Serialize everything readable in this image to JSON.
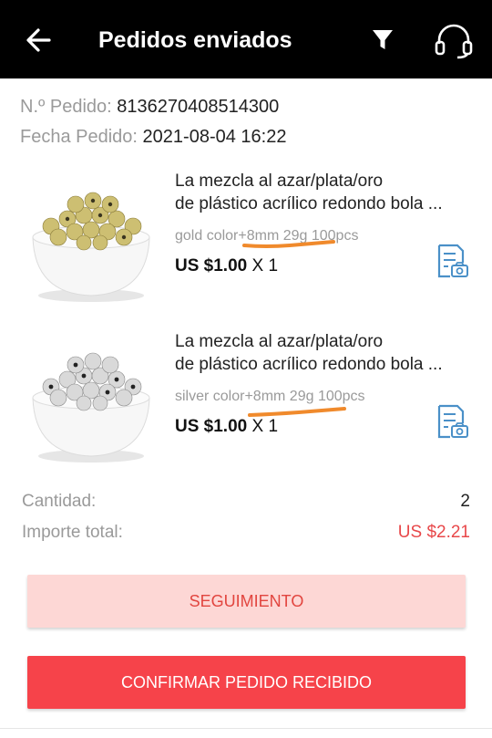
{
  "header": {
    "title": "Pedidos enviados",
    "back_icon": "arrow-left-icon",
    "filter_icon": "filter-icon",
    "support_icon": "headset-icon",
    "background": "#000000"
  },
  "order": {
    "number_label": "N.º Pedido:",
    "number_value": "8136270408514300",
    "date_label": "Fecha Pedido:",
    "date_value": "2021-08-04 16:22"
  },
  "products": [
    {
      "title_line1": "La mezcla al azar/plata/oro",
      "title_line2": "de plástico acrílico redondo bola ...",
      "variant": "gold color+8mm 29g 100pcs",
      "price": "US $1.00",
      "qty": "X 1",
      "image": "gold-beads-bowl",
      "action_icon": "snapshot-icon"
    },
    {
      "title_line1": "La mezcla al azar/plata/oro",
      "title_line2": "de plástico acrílico redondo bola ...",
      "variant": "silver color+8mm 29g 100pcs",
      "price": "US $1.00",
      "qty": "X 1",
      "image": "silver-beads-bowl",
      "action_icon": "snapshot-icon"
    }
  ],
  "summary": {
    "quantity_label": "Cantidad:",
    "quantity_value": "2",
    "total_label": "Importe total:",
    "total_value": "US $2.21"
  },
  "buttons": {
    "tracking": "SEGUIMIENTO",
    "confirm": "CONFIRMAR PEDIDO RECIBIDO"
  },
  "colors": {
    "accent": "#f6434a",
    "accent_light": "#fdd7d5",
    "price_red": "#e8484a",
    "icon_blue": "#4a90c8",
    "annotation_orange": "#f08a2c"
  }
}
